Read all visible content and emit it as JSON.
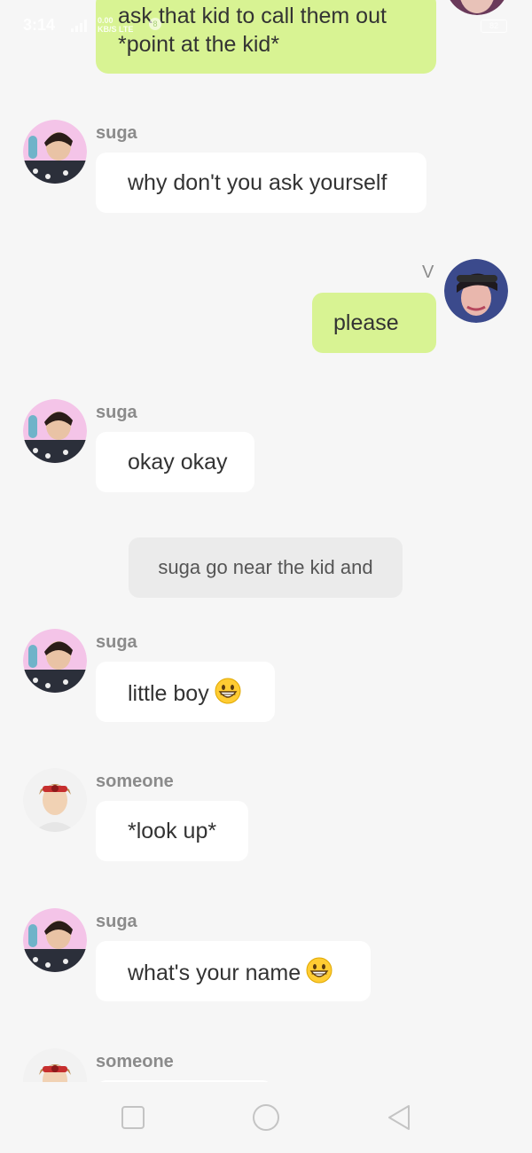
{
  "status_bar": {
    "time": "3:14",
    "net_speed": "0.00",
    "net_unit": "KB/S",
    "net_type": "LTE",
    "notification": "8",
    "battery": "82"
  },
  "messages": [
    {
      "kind": "out",
      "sender": "",
      "text": "ask that kid to call them out *point at the kid*"
    },
    {
      "kind": "in",
      "sender": "suga",
      "text": "why don't you ask yourself"
    },
    {
      "kind": "out",
      "sender": "V",
      "text": "please"
    },
    {
      "kind": "in",
      "sender": "suga",
      "text": "okay okay"
    },
    {
      "kind": "narration",
      "text": "suga go near the kid and"
    },
    {
      "kind": "in",
      "sender": "suga",
      "text": "little boy",
      "emoji": "grinning-face"
    },
    {
      "kind": "in",
      "sender": "someone",
      "text": "*look up*"
    },
    {
      "kind": "in",
      "sender": "suga",
      "text": "what's your name",
      "emoji": "grinning-face"
    },
    {
      "kind": "in",
      "sender": "someone",
      "text": ""
    }
  ],
  "nav": {
    "recents": "square-icon",
    "home": "circle-icon",
    "back": "triangle-back-icon"
  },
  "colors": {
    "outgoing_bubble": "#d8f393",
    "incoming_bubble": "#ffffff",
    "narration_bubble": "#ebebeb",
    "background": "#f6f6f6"
  }
}
